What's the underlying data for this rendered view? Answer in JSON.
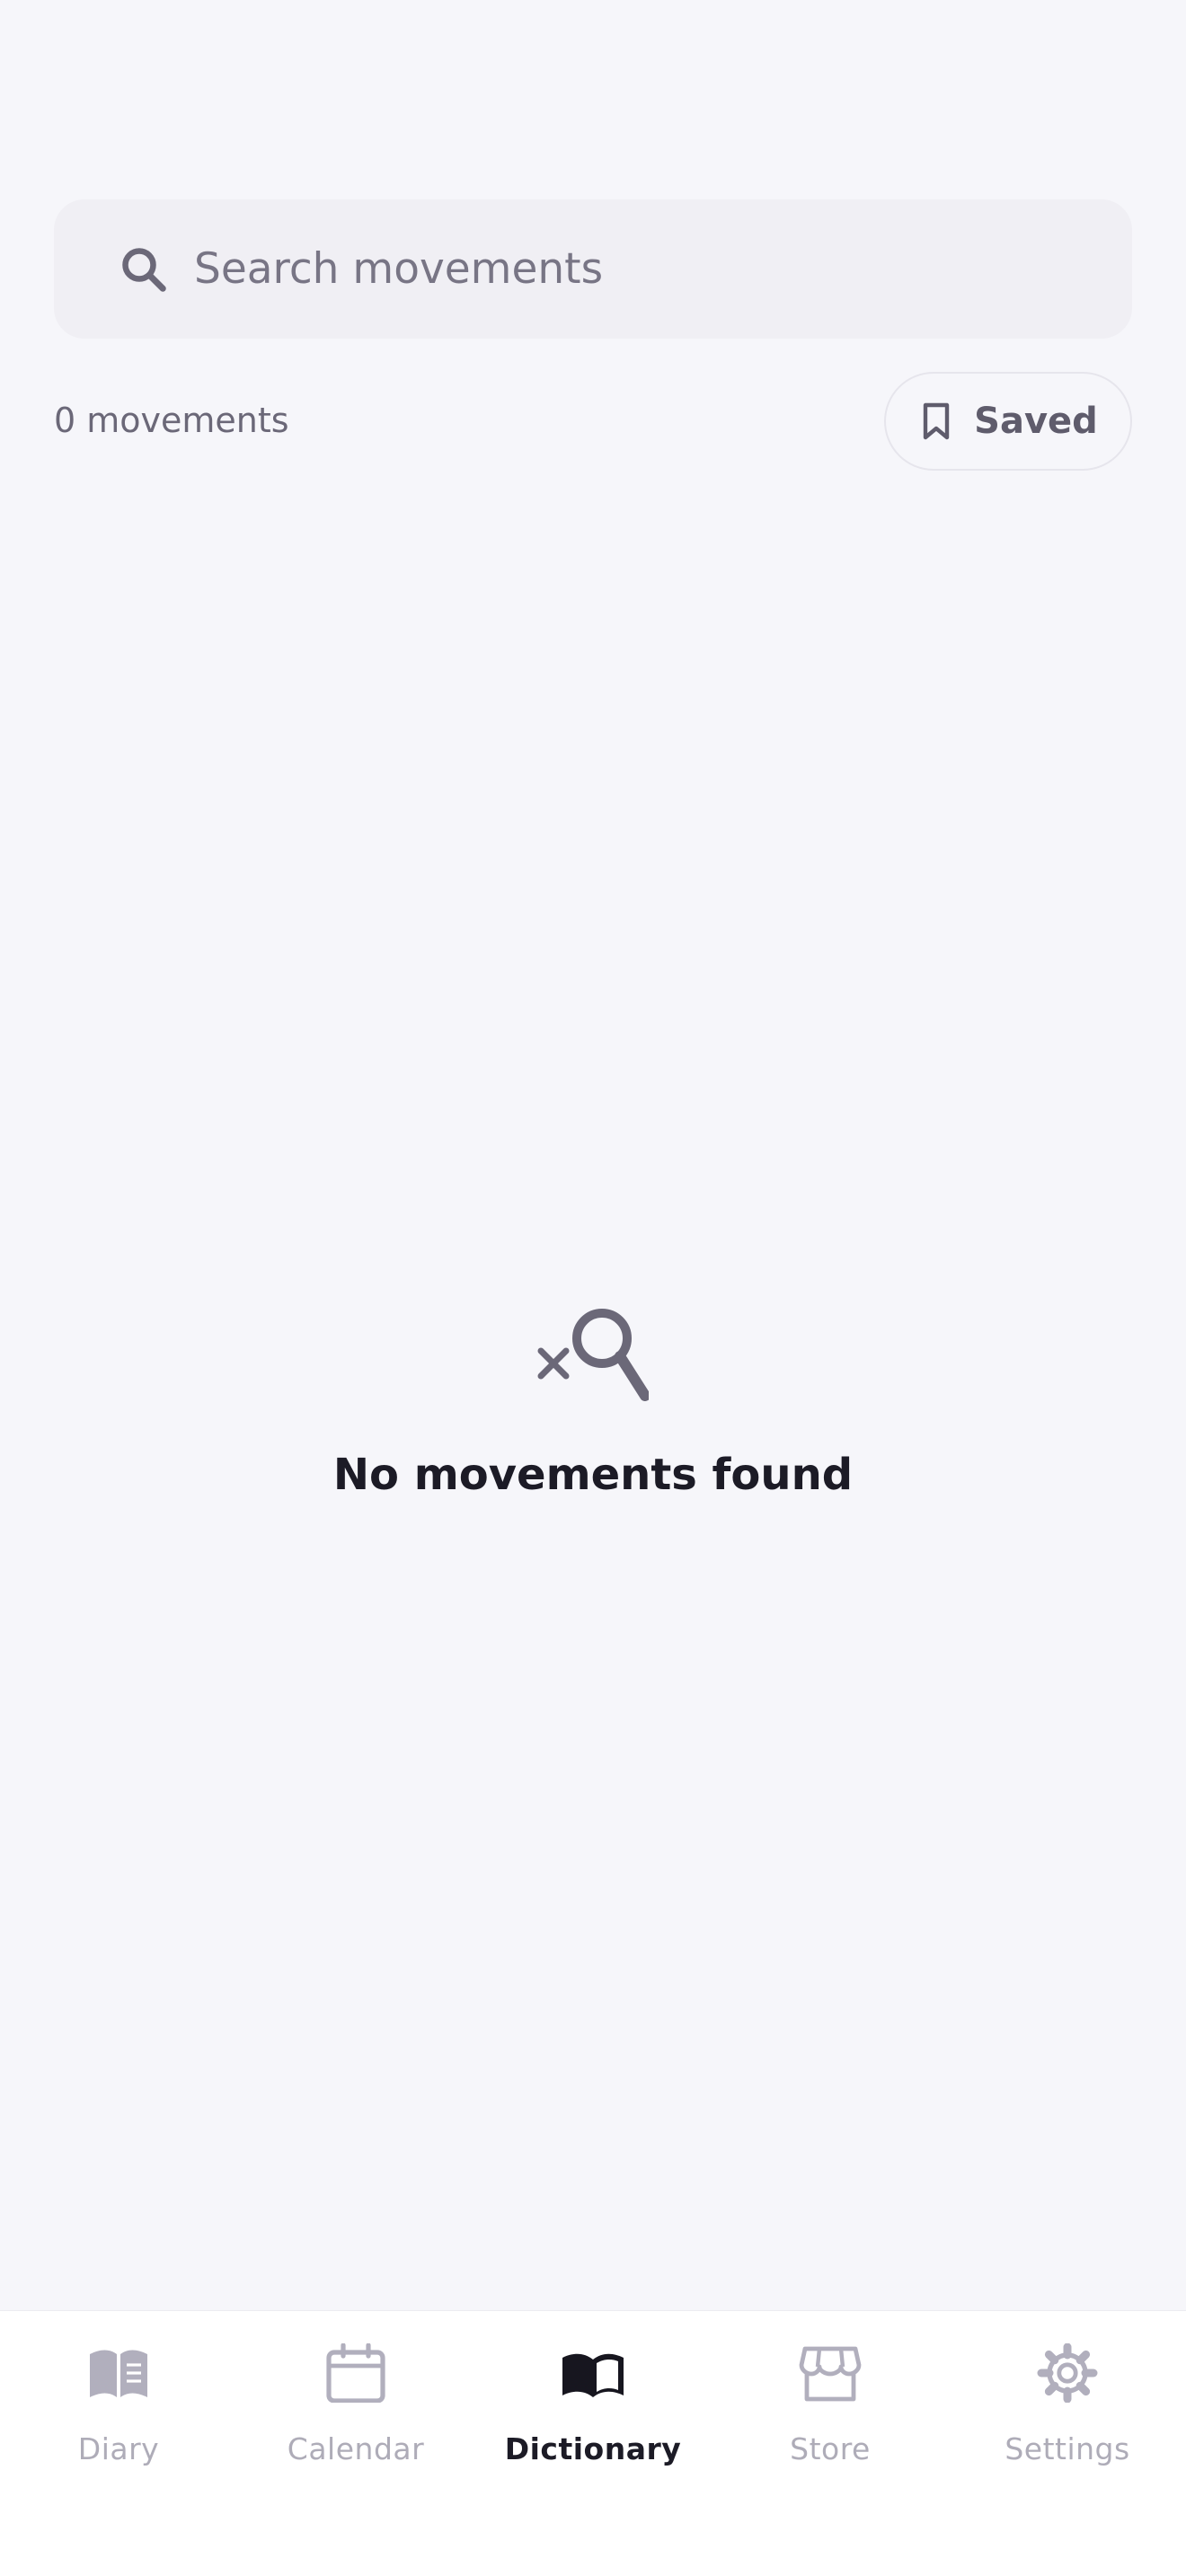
{
  "search": {
    "placeholder": "Search movements",
    "value": ""
  },
  "toolbar": {
    "count_label": "0 movements",
    "saved_label": "Saved"
  },
  "empty_state": {
    "title": "No movements found"
  },
  "tabs": [
    {
      "label": "Diary",
      "icon": "book-icon",
      "active": false
    },
    {
      "label": "Calendar",
      "icon": "calendar-icon",
      "active": false
    },
    {
      "label": "Dictionary",
      "icon": "open-book-icon",
      "active": true
    },
    {
      "label": "Store",
      "icon": "storefront-icon",
      "active": false
    },
    {
      "label": "Settings",
      "icon": "gear-icon",
      "active": false
    }
  ],
  "colors": {
    "background": "#f6f6fa",
    "search_background": "#f0eff4",
    "text_primary": "#1c1b26",
    "text_secondary": "#6b6878",
    "icon_muted": "#b1afbd",
    "icon_dark": "#6b6878"
  }
}
